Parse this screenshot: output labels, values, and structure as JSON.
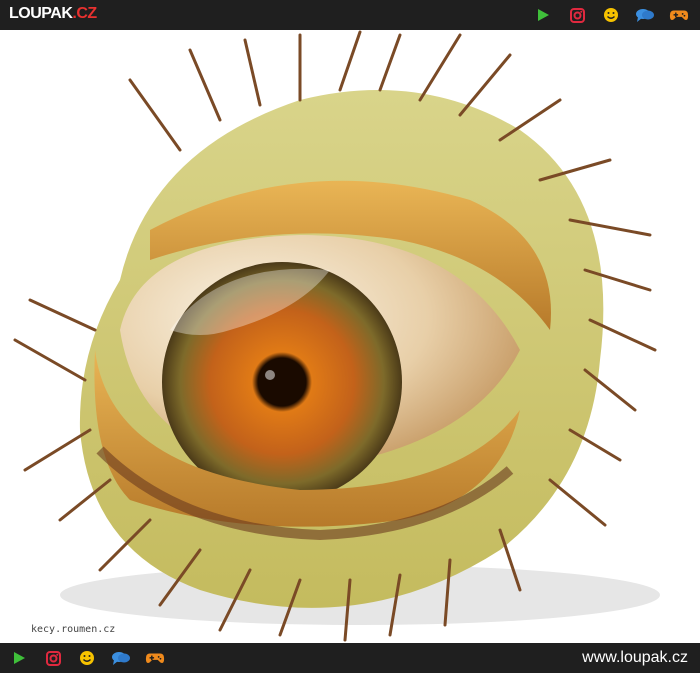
{
  "header": {
    "logo_main": "LOUPAK",
    "logo_suffix": ".CZ",
    "icons": [
      "play-icon",
      "instagram-icon",
      "smiley-icon",
      "chat-icon",
      "gamepad-icon"
    ]
  },
  "photo": {
    "watermark": "kecy.roumen.cz"
  },
  "footer": {
    "site_url": "www.loupak.cz",
    "icons": [
      "play-icon",
      "instagram-icon",
      "smiley-icon",
      "chat-icon",
      "gamepad-icon"
    ]
  },
  "colors": {
    "bar": "#1f1f1f",
    "play": "#3fbf3a",
    "instagram": "#e0293f",
    "smiley": "#f6c200",
    "chat": "#3b8fe0",
    "gamepad": "#f08a1c"
  }
}
